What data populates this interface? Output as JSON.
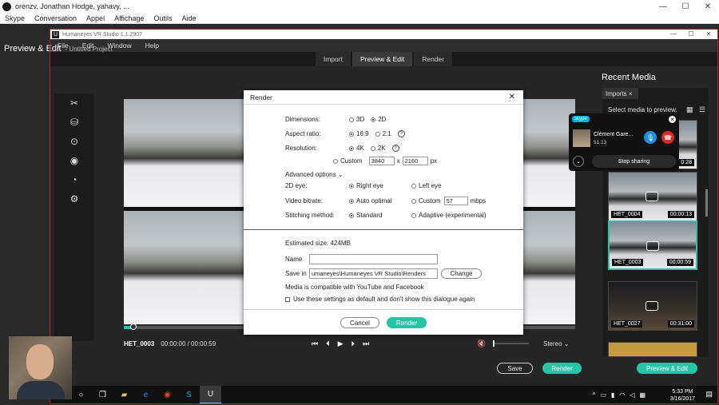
{
  "skype": {
    "title": "orenzv, Jonathan Hodge, yahavy, ...",
    "menu": [
      "Skype",
      "Conversation",
      "Appel",
      "Affichage",
      "Outils",
      "Aide"
    ],
    "controls": [
      "—",
      "☐",
      "✕"
    ],
    "call": {
      "brand": "skype",
      "caller": "Clément Gare...",
      "duration": "51:13",
      "stop_label": "Stop sharing"
    }
  },
  "app": {
    "title": "Humaneyes VR Studio 1.1.2907",
    "logo": "U",
    "menu": [
      "File",
      "Edit",
      "Window",
      "Help"
    ],
    "tabs": [
      {
        "label": "Import",
        "active": false
      },
      {
        "label": "Preview & Edit",
        "active": true
      },
      {
        "label": "Render",
        "active": false
      }
    ],
    "section_title": "Preview & Edit",
    "project": "- Untitled Project",
    "player": {
      "clip": "HET_0003",
      "time": "00:00:00 / 00:00:59",
      "audio_mode": "Stereo",
      "progress": 0.02
    },
    "save_label": "Save",
    "render_label": "Render"
  },
  "recent": {
    "title": "Recent Media",
    "tab": "Imports",
    "select_text": "Select media to preview.",
    "items": [
      {
        "name": "",
        "duration": "0:28"
      },
      {
        "name": "HET_0004",
        "duration": "00:00:13"
      },
      {
        "name": "HET_0003",
        "duration": "00:00:59"
      },
      {
        "name": "HET_0027",
        "duration": "00:31:00"
      }
    ],
    "button_label": "Preview & Edit"
  },
  "dialog": {
    "title": "Render",
    "dimensions": {
      "label": "Dimensions:",
      "options": [
        "3D",
        "2D"
      ],
      "selected": "2D"
    },
    "aspect": {
      "label": "Aspect ratio:",
      "options": [
        "16:9",
        "2:1"
      ],
      "selected": "16:9"
    },
    "resolution": {
      "label": "Resolution:",
      "options": [
        "4K",
        "2K"
      ],
      "selected": "4K",
      "custom_label": "Custom",
      "width": "3840",
      "x": "x",
      "height": "2160",
      "unit": "px"
    },
    "advanced_label": "Advanced options",
    "eye": {
      "label": "2D eye:",
      "options": [
        "Right eye",
        "Left eye"
      ],
      "selected": "Right eye"
    },
    "bitrate": {
      "label": "Video bitrate:",
      "auto": "Auto optimal",
      "custom": "Custom",
      "value": "57",
      "unit": "mbps"
    },
    "stitching": {
      "label": "Stitching method:",
      "options": [
        "Standard",
        "Adaptive (experimental)"
      ],
      "selected": "Standard"
    },
    "estimated": "Estimated size: 424MB",
    "name_label": "Name",
    "name_value": "",
    "savein_label": "Save in",
    "savein_value": "umaneyes\\Humaneyes VR Studio\\Renders",
    "change_label": "Change",
    "compat": "Media is compatible with YouTube and Facebook",
    "default_label": "Use these settings as default and don't show this dialogue again",
    "cancel_label": "Cancel",
    "render_label": "Render"
  },
  "taskbar": {
    "time": "5:33 PM",
    "date": "3/16/2017"
  },
  "colors": {
    "accent": "#25c6a6",
    "frame": "#d0141c",
    "skype_blue": "#00aff0"
  }
}
